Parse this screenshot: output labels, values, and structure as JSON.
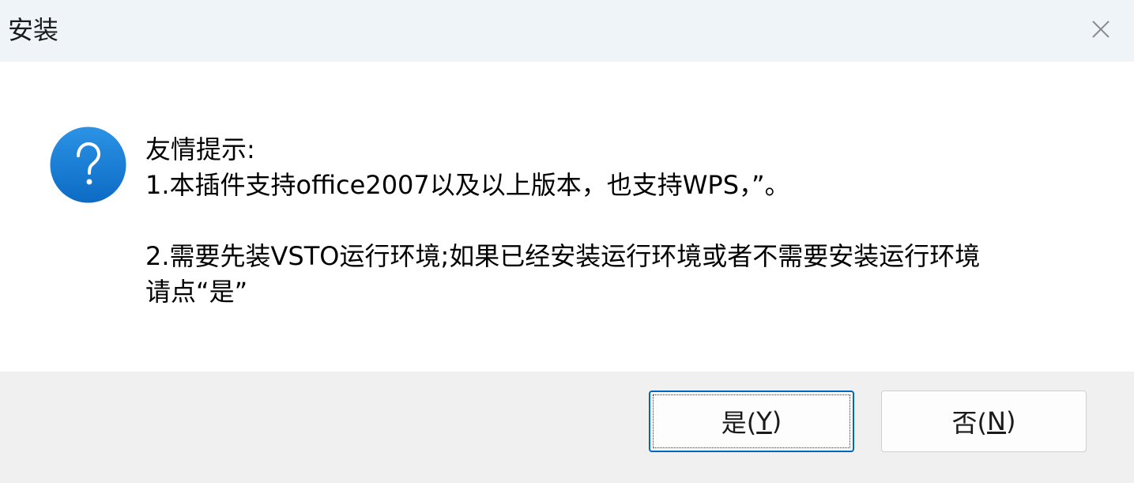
{
  "window": {
    "title": "安装"
  },
  "icons": {
    "close": "close-icon",
    "question": "question-icon"
  },
  "colors": {
    "titlebar_bg": "#eff4f9",
    "footer_bg": "#f0f0f0",
    "icon_blue": "#1a7fd4",
    "default_button_border": "#0067c0"
  },
  "message": {
    "lines": [
      "友情提示:",
      "1.本插件支持office2007以及以上版本，也支持WPS，”。",
      "",
      "2.需要先装VSTO运行环境;如果已经安装运行环境或者不需要安装运行环境",
      "请点“是”"
    ]
  },
  "buttons": {
    "yes": {
      "prefix": "是(",
      "accel": "Y",
      "suffix": ")"
    },
    "no": {
      "prefix": "否(",
      "accel": "N",
      "suffix": ")"
    }
  }
}
